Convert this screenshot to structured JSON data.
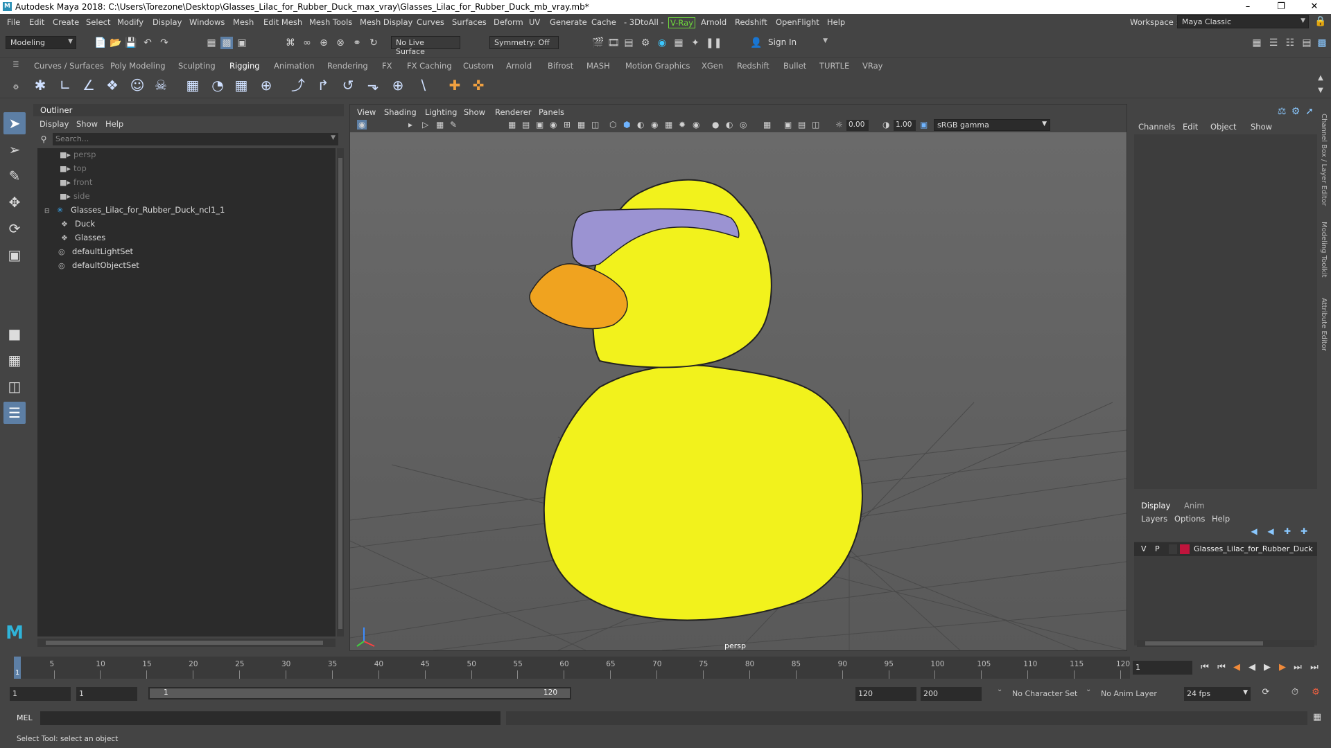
{
  "window": {
    "title": "Autodesk Maya 2018: C:\\Users\\Torezone\\Desktop\\Glasses_Lilac_for_Rubber_Duck_max_vray\\Glasses_Lilac_for_Rubber_Duck_mb_vray.mb*",
    "logo": "M"
  },
  "menubar": {
    "items": [
      "File",
      "Edit",
      "Create",
      "Select",
      "Modify",
      "Display",
      "Windows",
      "Mesh",
      "Edit Mesh",
      "Mesh Tools",
      "Mesh Display",
      "Curves",
      "Surfaces",
      "Deform",
      "UV",
      "Generate",
      "Cache",
      "- 3DtoAll -",
      "V-Ray",
      "Arnold",
      "Redshift",
      "OpenFlight",
      "Help"
    ],
    "workspace_label": "Workspace :",
    "workspace_value": "Maya Classic"
  },
  "statusline": {
    "mode": "Modeling",
    "live_surface": "No Live Surface",
    "symmetry": "Symmetry: Off",
    "sign_in": "Sign In"
  },
  "shelf": {
    "tabs": [
      "Curves / Surfaces",
      "Poly Modeling",
      "Sculpting",
      "Rigging",
      "Animation",
      "Rendering",
      "FX",
      "FX Caching",
      "Custom",
      "Arnold",
      "Bifrost",
      "MASH",
      "Motion Graphics",
      "XGen",
      "Redshift",
      "Bullet",
      "TURTLE",
      "VRay"
    ],
    "active_tab": "Rigging"
  },
  "outliner": {
    "title": "Outliner",
    "menu": [
      "Display",
      "Show",
      "Help"
    ],
    "search_placeholder": "Search...",
    "items": [
      {
        "label": "persp",
        "icon": "camera-icon",
        "dim": true
      },
      {
        "label": "top",
        "icon": "camera-icon",
        "dim": true
      },
      {
        "label": "front",
        "icon": "camera-icon",
        "dim": true
      },
      {
        "label": "side",
        "icon": "camera-icon",
        "dim": true
      },
      {
        "label": "Glasses_Lilac_for_Rubber_Duck_ncl1_1",
        "icon": "group-icon",
        "dim": false
      },
      {
        "label": "Duck",
        "icon": "mesh-icon",
        "dim": false
      },
      {
        "label": "Glasses",
        "icon": "mesh-icon",
        "dim": false
      },
      {
        "label": "defaultLightSet",
        "icon": "set-icon",
        "dim": false
      },
      {
        "label": "defaultObjectSet",
        "icon": "set-icon",
        "dim": false
      }
    ]
  },
  "viewport": {
    "menu": [
      "View",
      "Shading",
      "Lighting",
      "Show",
      "Renderer",
      "Panels"
    ],
    "exposure": "0.00",
    "gamma_value": "1.00",
    "color_space": "sRGB gamma",
    "camera": "persp",
    "colors": {
      "duck": "#f2f21c",
      "glasses": "#9b93d2",
      "beak": "#f0a31f"
    }
  },
  "channelbox": {
    "menu": [
      "Channels",
      "Edit",
      "Object",
      "Show"
    ],
    "layer_tabs": [
      "Display",
      "Anim"
    ],
    "layer_menu": [
      "Layers",
      "Options",
      "Help"
    ],
    "layer": {
      "v": "V",
      "p": "P",
      "name": "Glasses_Lilac_for_Rubber_Duck",
      "color": "#c0143c"
    },
    "side_tabs": [
      "Channel Box / Layer Editor",
      "Modeling Toolkit",
      "Attribute Editor"
    ]
  },
  "timeslider": {
    "ticks": [
      "5",
      "10",
      "15",
      "20",
      "25",
      "30",
      "35",
      "40",
      "45",
      "50",
      "55",
      "60",
      "65",
      "70",
      "75",
      "80",
      "85",
      "90",
      "95",
      "100",
      "105",
      "110",
      "115",
      "120"
    ],
    "current_frame": "1",
    "current_frame_field": "1"
  },
  "range": {
    "start": "1",
    "playback_start": "1",
    "slider_start": "1",
    "slider_end": "120",
    "playback_end": "120",
    "end": "200",
    "character_set": "No Character Set",
    "anim_layer": "No Anim Layer",
    "fps": "24 fps"
  },
  "cmdline": {
    "label": "MEL"
  },
  "helpline": {
    "text": "Select Tool: select an object"
  }
}
